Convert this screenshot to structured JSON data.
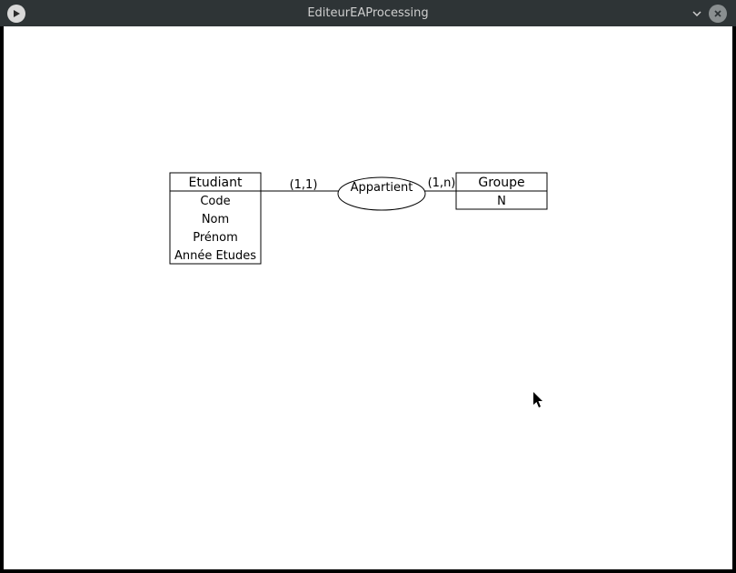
{
  "window": {
    "title": "EditeurEAProcessing"
  },
  "diagram": {
    "entities": [
      {
        "name": "Etudiant",
        "attributes": [
          "Code",
          "Nom",
          "Prénom",
          "Année Etudes"
        ]
      },
      {
        "name": "Groupe",
        "attributes": [
          "N"
        ]
      }
    ],
    "relationship": {
      "name": "Appartient",
      "left_cardinality": "(1,1)",
      "right_cardinality": "(1,n)"
    }
  }
}
